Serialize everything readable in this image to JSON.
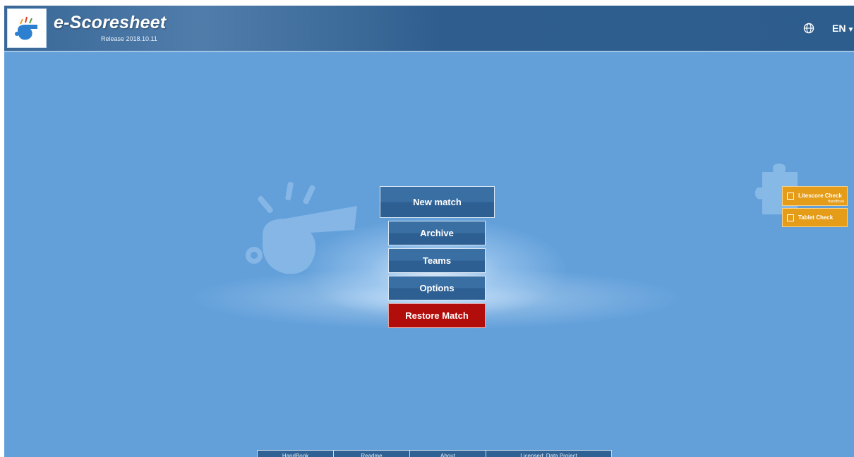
{
  "header": {
    "title": "e-Scoresheet",
    "release": "Release 2018.10.11",
    "language": "EN",
    "globe_icon": "globe-icon",
    "caret_icon": "chevron-down-icon"
  },
  "menu": {
    "new_match": "New match",
    "archive": "Archive",
    "teams": "Teams",
    "options": "Options",
    "restore_match": "Restore Match"
  },
  "side_panel": {
    "litescore_check": "Litescore Check",
    "litescore_sub": "HandBook",
    "tablet_check": "Tablet Check"
  },
  "footer": {
    "links": [
      "HandBook",
      "Readme",
      "About",
      "Licensed: Data Project"
    ]
  },
  "colors": {
    "background": "#63a0da",
    "header": "#2e5f91",
    "button": "#3a6fa4",
    "restore": "#b10d0a",
    "side_button": "#e59d19"
  }
}
